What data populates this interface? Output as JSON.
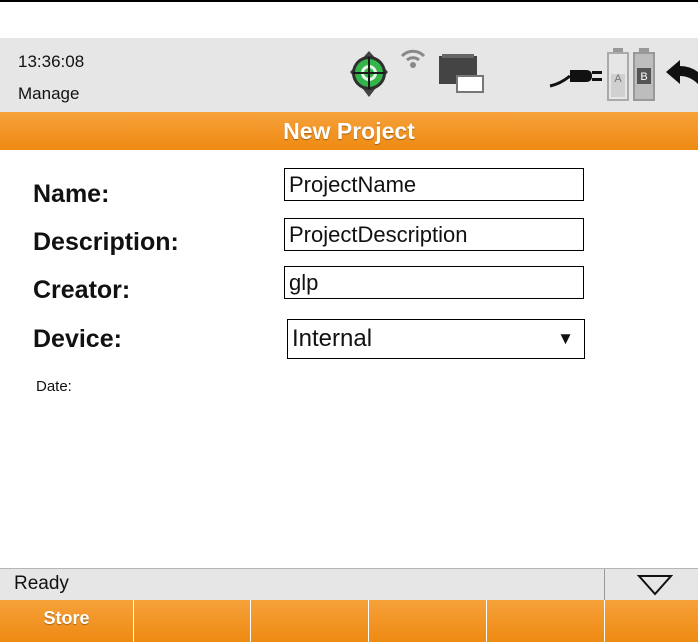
{
  "header": {
    "time": "13:36:08",
    "mode": "Manage",
    "icons": [
      "target-icon",
      "wifi-icon",
      "sd-card-icon",
      "power-plug-icon",
      "battery-a-icon",
      "battery-b-icon",
      "back-arrow-icon"
    ],
    "battery_labels": [
      "A",
      "B"
    ]
  },
  "title": "New Project",
  "form": {
    "name_label": "Name:",
    "name_value": "ProjectName",
    "description_label": "Description:",
    "description_value": "ProjectDescription",
    "creator_label": "Creator:",
    "creator_value": "glp",
    "device_label": "Device:",
    "device_value": "Internal",
    "device_arrow": "▼",
    "date_label": "Date:"
  },
  "status": {
    "text": "Ready",
    "collapse_icon": "triangle-down-icon"
  },
  "softkeys": [
    "Store",
    "",
    "",
    "",
    "",
    ""
  ],
  "colors": {
    "accent": "#f0901c",
    "header_bg": "#e6e6e6",
    "target_green": "#33b54a"
  }
}
